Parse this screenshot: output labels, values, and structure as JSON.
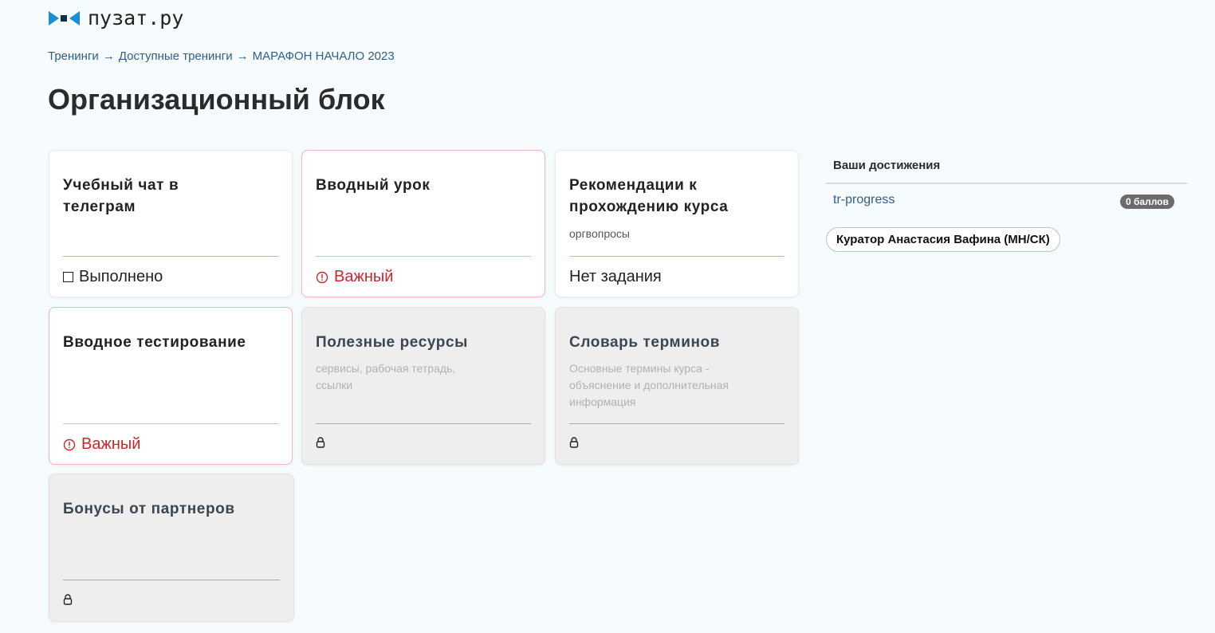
{
  "logo": {
    "text": "пузат.ру",
    "icon": "bow-tie-logo-icon",
    "colors": [
      "#1a8fd6",
      "#0c2f4e"
    ]
  },
  "breadcrumb": {
    "items": [
      "Тренинги",
      "Доступные тренинги",
      "МАРАФОН НАЧАЛО 2023"
    ],
    "separator": "→"
  },
  "page_title": "Организационный блок",
  "cards": [
    {
      "title": "Учебный чат в телеграм",
      "subtitle": "",
      "status": "Выполнено",
      "status_icon": "checkbox-icon",
      "state": "normal"
    },
    {
      "title": "Вводный урок",
      "subtitle": "",
      "status": "Важный",
      "status_icon": "alert-circle-icon",
      "state": "important"
    },
    {
      "title": "Рекомендации к прохождению курса",
      "subtitle": "оргвопросы",
      "status": "Нет задания",
      "status_icon": "",
      "state": "normal"
    },
    {
      "title": "Вводное тестирование",
      "subtitle": "",
      "status": "Важный",
      "status_icon": "alert-circle-icon",
      "state": "important"
    },
    {
      "title": "Полезные ресурсы",
      "subtitle": "сервисы, рабочая тетрадь, ссылки",
      "status": "",
      "status_icon": "lock-icon",
      "state": "locked"
    },
    {
      "title": "Словарь терминов",
      "subtitle": "Основные термины курса - объяснение и дополнительная информация",
      "status": "",
      "status_icon": "lock-icon",
      "state": "locked"
    },
    {
      "title": "Бонусы от партнеров",
      "subtitle": "",
      "status": "",
      "status_icon": "lock-icon",
      "state": "locked"
    }
  ],
  "achievements": {
    "title": "Ваши достижения",
    "link": "tr-progress",
    "badge": "0 баллов",
    "curator_button": "Куратор Анастасия Вафина (МН/СК)"
  },
  "colors": {
    "background": "#f6fbfd",
    "link": "#2f5f8a",
    "important": "#c8282d",
    "locked_bg": "#eeeeee"
  }
}
